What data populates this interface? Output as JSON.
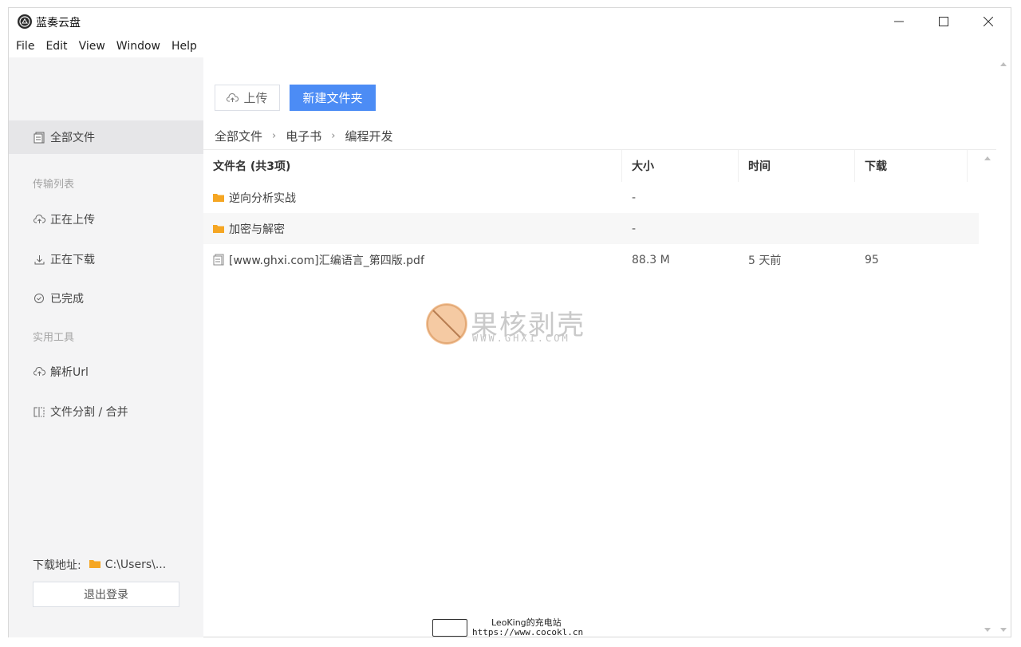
{
  "window": {
    "title": "蓝奏云盘"
  },
  "menu": [
    "File",
    "Edit",
    "View",
    "Window",
    "Help"
  ],
  "toolbar": {
    "upload_label": "上传",
    "new_folder_label": "新建文件夹"
  },
  "breadcrumb": [
    "全部文件",
    "电子书",
    "编程开发"
  ],
  "sidebar": {
    "all_files": "全部文件",
    "section_transfer": "传输列表",
    "uploading": "正在上传",
    "downloading": "正在下载",
    "completed": "已完成",
    "section_tools": "实用工具",
    "parse_url": "解析Url",
    "split_merge": "文件分割 / 合并",
    "download_label": "下载地址:",
    "download_path": "C:\\Users\\...",
    "logout": "退出登录"
  },
  "table": {
    "columns": [
      "文件名 (共3项)",
      "大小",
      "时间",
      "下载"
    ],
    "rows": [
      {
        "type": "folder",
        "name": "逆向分析实战",
        "size": "-",
        "time": "",
        "downloads": ""
      },
      {
        "type": "folder",
        "name": "加密与解密",
        "size": "-",
        "time": "",
        "downloads": ""
      },
      {
        "type": "file",
        "name": "[www.ghxi.com]汇编语言_第四版.pdf",
        "size": "88.3 M",
        "time": "5 天前",
        "downloads": "95"
      }
    ]
  },
  "watermark": {
    "brand": "果核剥壳",
    "url": "WWW.GHXI.COM",
    "credit_line1": "LeoKing的充电站",
    "credit_line2": "https://www.cocokl.cn"
  },
  "colors": {
    "primary": "#4c8cf5",
    "folder": "#f5a623",
    "sidebar_bg": "#f4f4f5"
  }
}
